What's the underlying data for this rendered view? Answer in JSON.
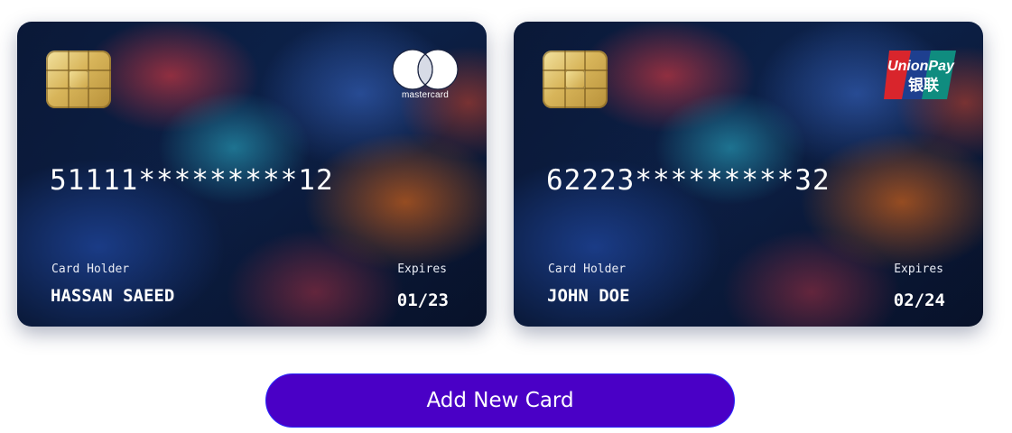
{
  "cards": [
    {
      "brand_icon": "mastercard-logo",
      "brand_text": "mastercard",
      "number": "51111*********12",
      "holder_label": "Card Holder",
      "holder_name": "HASSAN SAEED",
      "expires_label": "Expires",
      "expiry": "01/23"
    },
    {
      "brand_icon": "unionpay-logo",
      "brand_text": "UnionPay",
      "brand_text_cn": "银联",
      "number": "62223*********32",
      "holder_label": "Card Holder",
      "holder_name": "JOHN DOE",
      "expires_label": "Expires",
      "expiry": "02/24"
    }
  ],
  "actions": {
    "add_card_label": "Add New Card"
  },
  "colors": {
    "button_bg": "#4a00c6",
    "button_border": "#2a2aff",
    "card_text": "#ffffff"
  }
}
